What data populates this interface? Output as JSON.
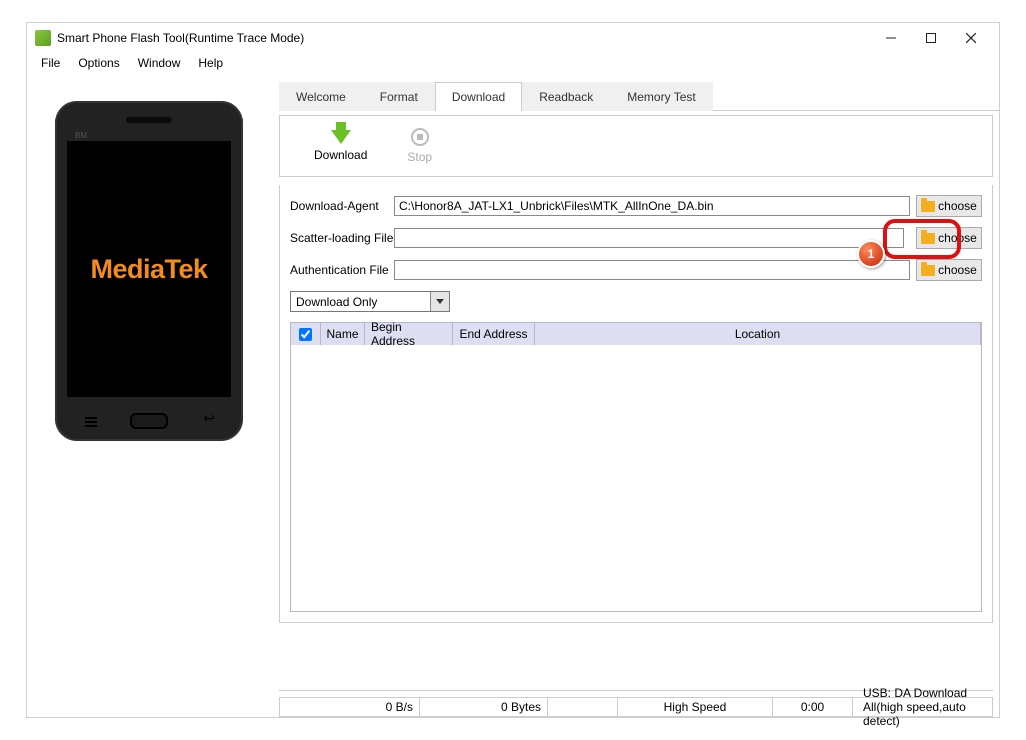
{
  "window": {
    "title": "Smart Phone Flash Tool(Runtime Trace Mode)"
  },
  "menu": {
    "file": "File",
    "options": "Options",
    "window": "Window",
    "help": "Help"
  },
  "phone": {
    "brand": "MediaTek",
    "bm": "BM"
  },
  "tabs": {
    "welcome": "Welcome",
    "format": "Format",
    "download": "Download",
    "readback": "Readback",
    "memtest": "Memory Test"
  },
  "toolbar": {
    "download": "Download",
    "stop": "Stop"
  },
  "form": {
    "da_label": "Download-Agent",
    "da_value": "C:\\Honor8A_JAT-LX1_Unbrick\\Files\\MTK_AllInOne_DA.bin",
    "scatter_label": "Scatter-loading File",
    "scatter_value": "",
    "auth_label": "Authentication File",
    "auth_value": "",
    "choose": "choose",
    "mode": "Download Only"
  },
  "table": {
    "name": "Name",
    "begin": "Begin Address",
    "end": "End Address",
    "location": "Location"
  },
  "status": {
    "rate": "0 B/s",
    "bytes": "0 Bytes",
    "blank": "",
    "speed": "High Speed",
    "time": "0:00",
    "usb": "USB: DA Download All(high speed,auto detect)"
  },
  "annotation": {
    "badge": "1"
  }
}
